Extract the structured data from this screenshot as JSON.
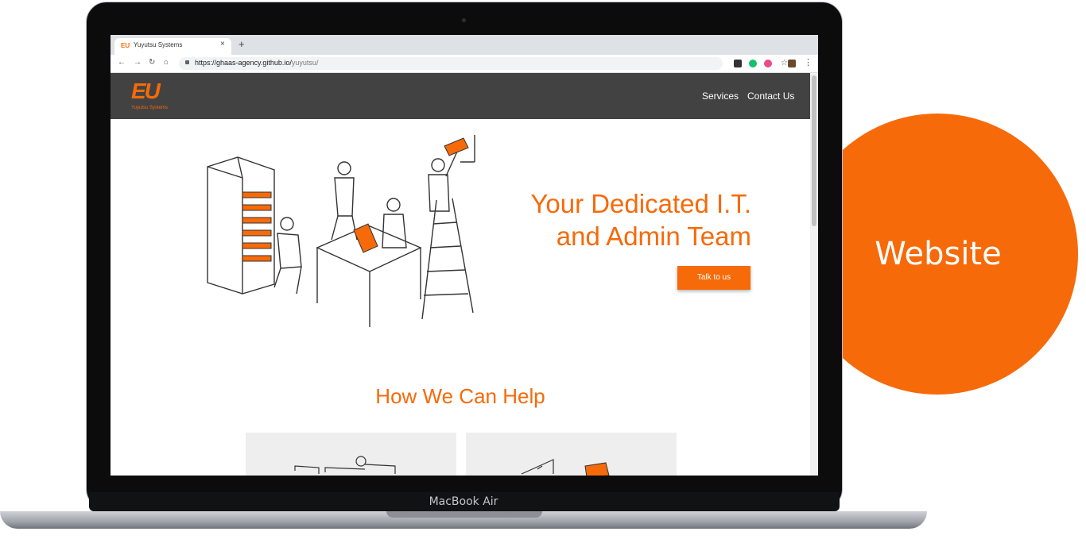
{
  "badge": {
    "label": "Website"
  },
  "device": {
    "label": "MacBook Air"
  },
  "browser": {
    "tab_title": "Yuyutsu Systems",
    "tab_favicon": "EU",
    "tab_close": "×",
    "new_tab": "+",
    "url_host": "https://ghaas-agency.github.io/",
    "url_path": "yuyutsu/",
    "back": "←",
    "forward": "→",
    "reload": "↻",
    "home": "⌂",
    "star": "☆",
    "menu": "⋮"
  },
  "site": {
    "logo_mark": "EU",
    "logo_text": "Yuyutsu Systems",
    "nav": {
      "services": "Services",
      "contact": "Contact Us"
    },
    "hero_line1": "Your Dedicated I.T.",
    "hero_line2": "and Admin Team",
    "cta": "Talk to us",
    "section_title": "How We Can Help"
  },
  "colors": {
    "accent": "#f66a0a",
    "header": "#424242"
  }
}
